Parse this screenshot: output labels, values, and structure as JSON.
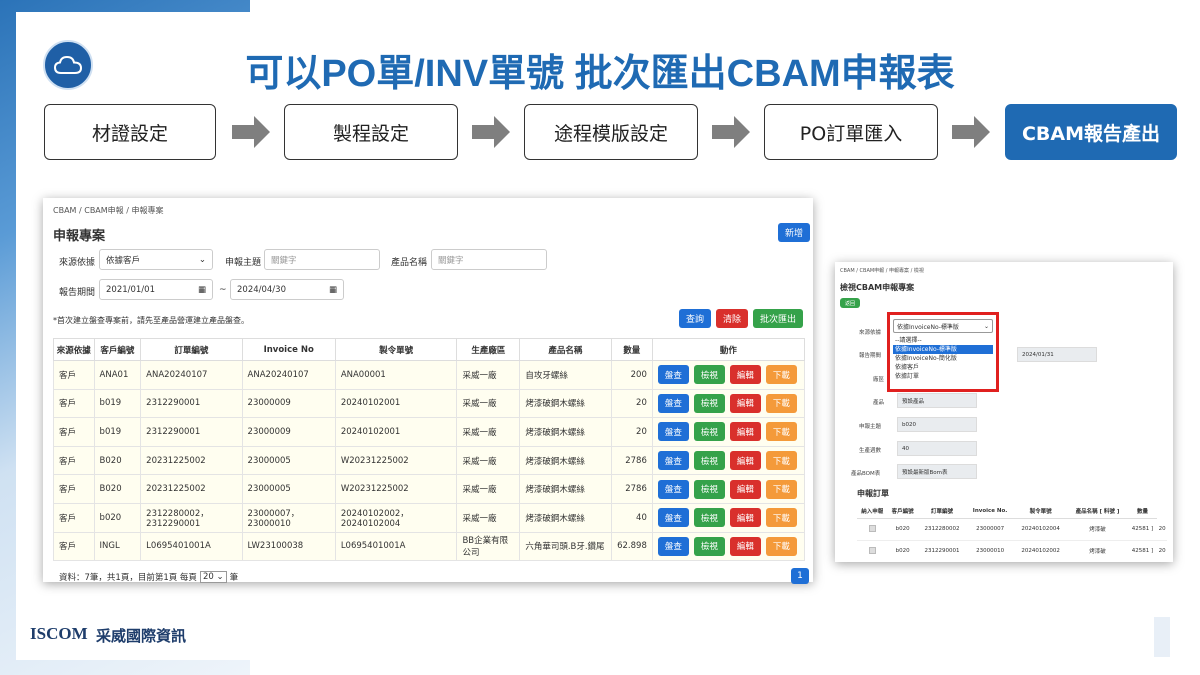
{
  "slide": {
    "title": "可以PO單/INV單號 批次匯出CBAM申報表",
    "steps": [
      "材證設定",
      "製程設定",
      "途程模版設定",
      "PO訂單匯入",
      "CBAM報告產出"
    ],
    "brand_en": "ISCOM",
    "brand_zh": "采威國際資訊"
  },
  "colors": {
    "accent": "#1f6ab3",
    "primary_button": "#1f6fd6",
    "danger": "#d9302c",
    "success": "#35a24a",
    "warning": "#f49a3a"
  },
  "left_screen": {
    "breadcrumb": "CBAM / CBAM申報 / 申報專案",
    "page_title": "申報專案",
    "new_button": "新增",
    "filters": {
      "source_label": "來源依據",
      "source_value": "依據客戶",
      "subject_label": "申報主題",
      "subject_placeholder": "關鍵字",
      "product_label": "產品名稱",
      "product_placeholder": "關鍵字",
      "period_label": "報告期間",
      "date_from": "2021/01/01",
      "date_sep": "~",
      "date_to": "2024/04/30"
    },
    "note": "*首次建立盤查專案前，請先至產品營運建立產品盤查。",
    "buttons": {
      "query": "查詢",
      "clear": "清除",
      "batch_export": "批次匯出"
    },
    "columns": [
      "來源依據",
      "客戶編號",
      "訂單編號",
      "Invoice No",
      "製令單號",
      "生產廠區",
      "產品名稱",
      "數量",
      "動作"
    ],
    "rows": [
      [
        "客戶",
        "ANA01",
        "ANA20240107",
        "ANA20240107",
        "ANA00001",
        "采威一廠",
        "自攻牙螺絲",
        "200"
      ],
      [
        "客戶",
        "b019",
        "2312290001",
        "23000009",
        "20240102001",
        "采威一廠",
        "烤漆破鋼木螺絲",
        "20"
      ],
      [
        "客戶",
        "b019",
        "2312290001",
        "23000009",
        "20240102001",
        "采威一廠",
        "烤漆破鋼木螺絲",
        "20"
      ],
      [
        "客戶",
        "B020",
        "20231225002",
        "23000005",
        "W20231225002",
        "采威一廠",
        "烤漆破鋼木螺絲",
        "2786"
      ],
      [
        "客戶",
        "B020",
        "20231225002",
        "23000005",
        "W20231225002",
        "采威一廠",
        "烤漆破鋼木螺絲",
        "2786"
      ],
      [
        "客戶",
        "b020",
        "2312280002，2312290001",
        "23000007，23000010",
        "20240102002，20240102004",
        "采威一廠",
        "烤漆破鋼木螺絲",
        "40"
      ],
      [
        "客戶",
        "INGL",
        "L0695401001A",
        "LW23100038",
        "L0695401001A",
        "BB企業有限公司",
        "六角華司頭.B牙.鑽尾",
        "62.898"
      ]
    ],
    "row_actions": [
      "盤查",
      "檢視",
      "編輯",
      "下載"
    ],
    "pager": {
      "summary": "資料：7筆，共1頁，目前第1頁  每頁",
      "page_size": "20",
      "unit": "筆",
      "current_page": "1"
    }
  },
  "right_screen": {
    "breadcrumb": "CBAM / CBAM申報 / 申報專案 / 檢視",
    "page_title": "檢視CBAM申報專案",
    "back_button": "返回",
    "source_label": "來源依據",
    "select_value": "依據InvoiceNo-標準版",
    "dropdown_options": [
      "--請選擇--",
      "依據InvoiceNo-標準版",
      "依據InvoiceNo-簡化版",
      "依據客戶",
      "依據訂單"
    ],
    "selected_option_index": 1,
    "labels": {
      "period": "報告期間",
      "factory": "廠區",
      "product": "產品",
      "subject": "申報主題",
      "count": "生產週數",
      "bom": "產品BOM表"
    },
    "values": {
      "date_end": "2024/01/31",
      "product": "預設產品",
      "subject": "b020",
      "count": "40",
      "bom": "預設最新版Bom表"
    },
    "orders_title": "申報訂單",
    "order_columns": [
      "納入申報",
      "客戶編號",
      "訂單編號",
      "Invoice No.",
      "製令單號",
      "產品名稱 [ 料號 ]",
      "數量"
    ],
    "orders": [
      [
        "b020",
        "2312280002",
        "23000007",
        "20240102004",
        "烤漆破",
        "42581 ]",
        "20"
      ],
      [
        "b020",
        "2312290001",
        "23000010",
        "20240102002",
        "烤漆破",
        "42581 ]",
        "20"
      ]
    ]
  }
}
